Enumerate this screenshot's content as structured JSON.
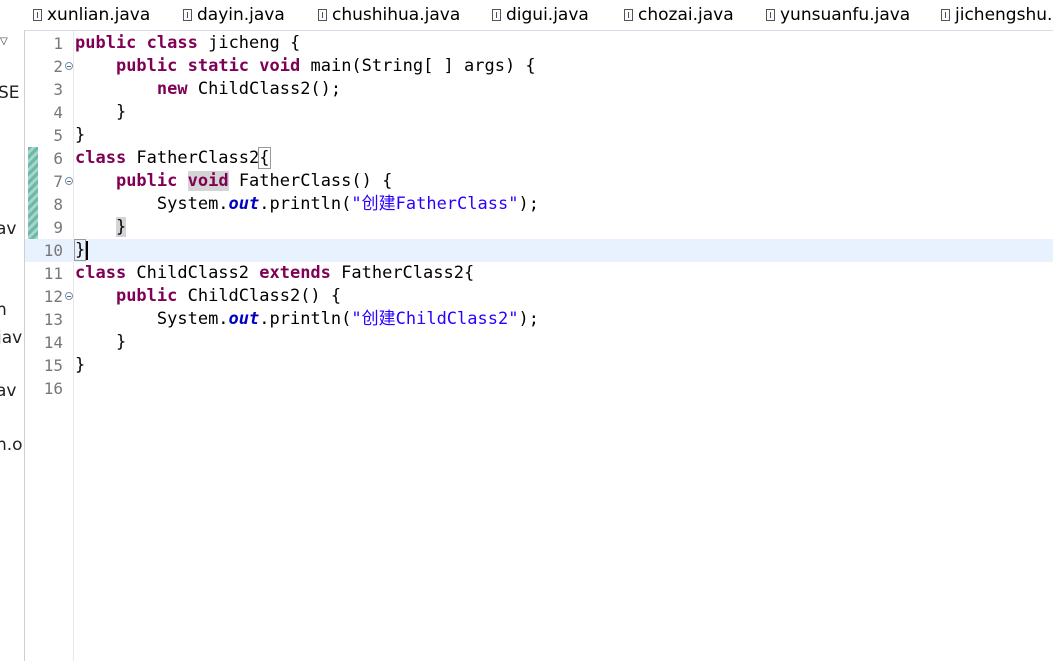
{
  "tabs": [
    {
      "label": "xunlian.java"
    },
    {
      "label": "dayin.java"
    },
    {
      "label": "chushihua.java"
    },
    {
      "label": "digui.java"
    },
    {
      "label": "chozai.java"
    },
    {
      "label": "yunsuanfu.java"
    },
    {
      "label": "jichengshu..."
    }
  ],
  "left_panel": {
    "fragments": [
      "SE",
      "av",
      "n",
      "jav",
      "av",
      "n.o"
    ]
  },
  "editor": {
    "line_numbers": [
      "1",
      "2",
      "3",
      "4",
      "5",
      "6",
      "7",
      "8",
      "9",
      "10",
      "11",
      "12",
      "13",
      "14",
      "15",
      "16"
    ],
    "current_line": "10",
    "code": {
      "l1": {
        "kw1": "public",
        "kw2": "class",
        "t1": " jicheng {"
      },
      "l2": {
        "kw1": "public",
        "kw2": "static",
        "kw3": "void",
        "t1": " main(String[ ] args) {"
      },
      "l3": {
        "kw1": "new",
        "t1": " ChildClass2();"
      },
      "l4": {
        "t1": "}"
      },
      "l5": {
        "t1": "}"
      },
      "l6": {
        "kw1": "class",
        "t1": " FatherClass2",
        "t2": "{"
      },
      "l7": {
        "kw1": "public",
        "kw2": "void",
        "t1": " FatherClass() {"
      },
      "l8": {
        "t1": "System.",
        "fld": "out",
        "t2": ".println(",
        "str": "\"创建FatherClass\"",
        "t3": ");"
      },
      "l9": {
        "t1": "}"
      },
      "l10": {
        "t1": "}"
      },
      "l11": {
        "kw1": "class",
        "t1": " ChildClass2 ",
        "kw2": "extends",
        "t2": " FatherClass2{"
      },
      "l12": {
        "kw1": "public",
        "t1": " ChildClass2() {"
      },
      "l13": {
        "t1": "System.",
        "fld": "out",
        "t2": ".println(",
        "str": "\"创建ChildClass2\"",
        "t3": ");"
      },
      "l14": {
        "t1": "}"
      },
      "l15": {
        "t1": "}"
      },
      "l16": {
        "t1": ""
      }
    }
  }
}
